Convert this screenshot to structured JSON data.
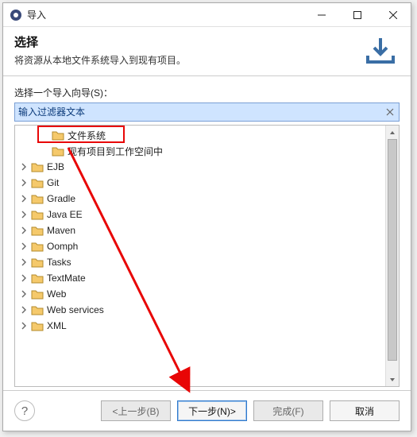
{
  "window": {
    "title": "导入"
  },
  "banner": {
    "title": "选择",
    "desc": "将资源从本地文件系统导入到现有项目。"
  },
  "filter": {
    "label": "选择一个导入向导(S)：",
    "placeholder": "输入过滤器文本"
  },
  "tree": {
    "child1": {
      "label": "文件系统"
    },
    "child2": {
      "label": "现有项目到工作空间中"
    },
    "items": [
      {
        "label": "EJB"
      },
      {
        "label": "Git"
      },
      {
        "label": "Gradle"
      },
      {
        "label": "Java EE"
      },
      {
        "label": "Maven"
      },
      {
        "label": "Oomph"
      },
      {
        "label": "Tasks"
      },
      {
        "label": "TextMate"
      },
      {
        "label": "Web"
      },
      {
        "label": "Web services"
      },
      {
        "label": "XML"
      }
    ]
  },
  "buttons": {
    "back": "<上一步(B)",
    "next": "下一步(N)>",
    "finish": "完成(F)",
    "cancel": "取消"
  }
}
